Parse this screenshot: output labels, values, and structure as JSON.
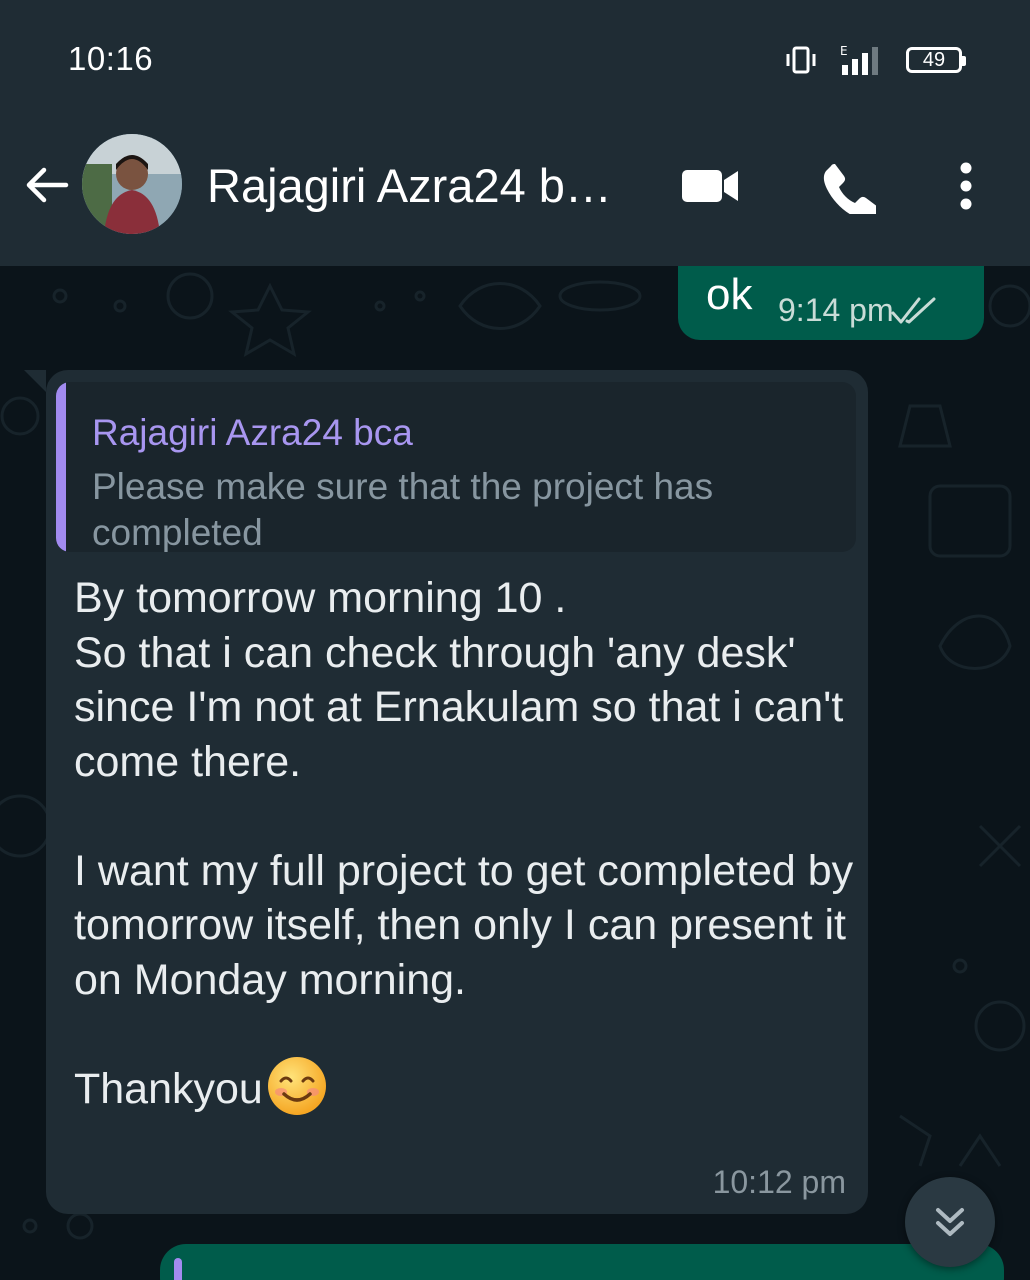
{
  "status_bar": {
    "time": "10:16",
    "battery": "49",
    "network": "E"
  },
  "app_bar": {
    "contact_name": "Rajagiri Azra24 b…",
    "icons": [
      "back-arrow-icon",
      "video-call-icon",
      "voice-call-icon",
      "more-options-icon"
    ]
  },
  "messages": {
    "outgoing": {
      "text": "ok",
      "time": "9:14 pm",
      "status": "read"
    },
    "incoming": {
      "quote_author": "Rajagiri Azra24 bca",
      "quote_text": "Please make sure that the project has completed",
      "body": "By tomorrow morning 10 .\nSo that i can check through 'any desk' since I'm not at Ernakulam so that i can't come there.\n\nI want my full project to get completed by tomorrow itself, then only I can present it on Monday morning.\n\nThankyou",
      "emoji": "smiling-face-icon",
      "time": "10:12 pm"
    }
  },
  "colors": {
    "header": "#1f2c34",
    "background": "#0b141a",
    "outgoing_bubble": "#005c4b",
    "incoming_bubble": "#1f2c34",
    "quote_accent": "#a28bf0",
    "read_ticks": "#c9dcd7"
  }
}
